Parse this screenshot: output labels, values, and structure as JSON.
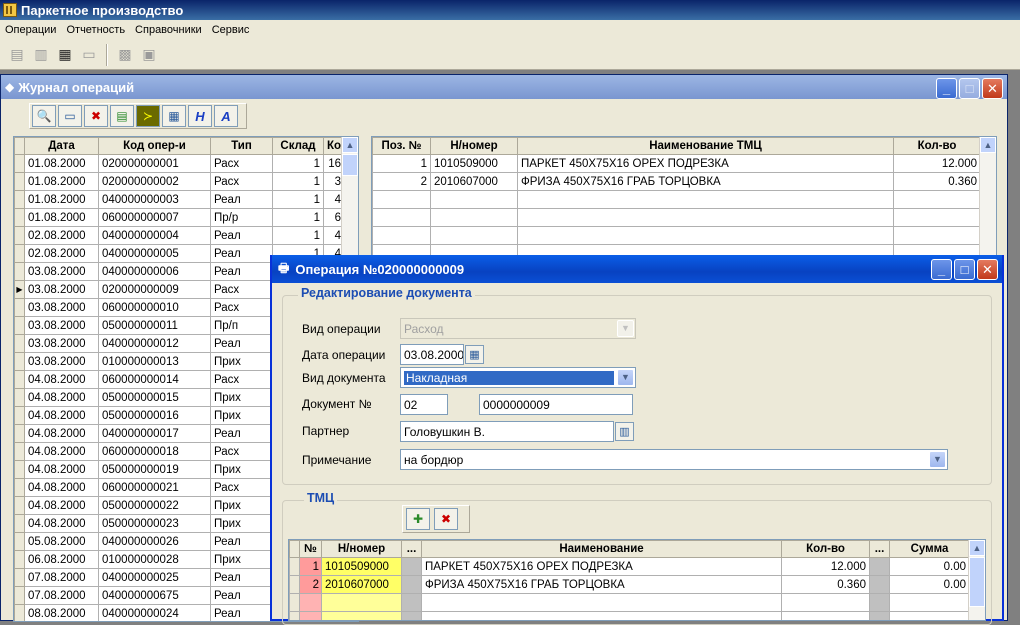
{
  "app": {
    "title": "Паркетное производство",
    "menu": [
      "Операции",
      "Отчетность",
      "Справочники",
      "Сервис"
    ]
  },
  "journal": {
    "title": "Журнал операций",
    "toolbar_letters": [
      "Н",
      "А"
    ],
    "left_headers": [
      "Дата",
      "Код опер-и",
      "Тип",
      "Склад",
      "Кол"
    ],
    "left_rows": [
      [
        "01.08.2000",
        "020000000001",
        "Расх",
        "1",
        "16"
      ],
      [
        "01.08.2000",
        "020000000002",
        "Расх",
        "1",
        "3"
      ],
      [
        "01.08.2000",
        "040000000003",
        "Реал",
        "1",
        "4"
      ],
      [
        "01.08.2000",
        "060000000007",
        "Пр/р",
        "1",
        "6"
      ],
      [
        "02.08.2000",
        "040000000004",
        "Реал",
        "1",
        "4"
      ],
      [
        "02.08.2000",
        "040000000005",
        "Реал",
        "1",
        "4"
      ],
      [
        "03.08.2000",
        "040000000006",
        "Реал",
        "",
        ""
      ],
      [
        "03.08.2000",
        "020000000009",
        "Расх",
        "",
        ""
      ],
      [
        "03.08.2000",
        "060000000010",
        "Расх",
        "",
        ""
      ],
      [
        "03.08.2000",
        "050000000011",
        "Пр/п",
        "",
        ""
      ],
      [
        "03.08.2000",
        "040000000012",
        "Реал",
        "",
        ""
      ],
      [
        "03.08.2000",
        "010000000013",
        "Прих",
        "",
        ""
      ],
      [
        "04.08.2000",
        "060000000014",
        "Расх",
        "",
        ""
      ],
      [
        "04.08.2000",
        "050000000015",
        "Прих",
        "",
        ""
      ],
      [
        "04.08.2000",
        "050000000016",
        "Прих",
        "",
        ""
      ],
      [
        "04.08.2000",
        "040000000017",
        "Реал",
        "",
        ""
      ],
      [
        "04.08.2000",
        "060000000018",
        "Расх",
        "",
        ""
      ],
      [
        "04.08.2000",
        "050000000019",
        "Прих",
        "",
        ""
      ],
      [
        "04.08.2000",
        "060000000021",
        "Расх",
        "",
        ""
      ],
      [
        "04.08.2000",
        "050000000022",
        "Прих",
        "",
        ""
      ],
      [
        "04.08.2000",
        "050000000023",
        "Прих",
        "",
        ""
      ],
      [
        "05.08.2000",
        "040000000026",
        "Реал",
        "",
        ""
      ],
      [
        "06.08.2000",
        "010000000028",
        "Прих",
        "",
        ""
      ],
      [
        "07.08.2000",
        "040000000025",
        "Реал",
        "",
        ""
      ],
      [
        "07.08.2000",
        "040000000675",
        "Реал",
        "",
        ""
      ],
      [
        "08.08.2000",
        "040000000024",
        "Реал",
        "",
        ""
      ]
    ],
    "current_row_index": 7,
    "right_headers": [
      "Поз. №",
      "Н/номер",
      "Наименование ТМЦ",
      "Кол-во"
    ],
    "right_rows": [
      [
        "1",
        "1010509000",
        "ПАРКЕТ 450X75X16 ОРЕХ ПОДРЕЗКА",
        "12.000"
      ],
      [
        "2",
        "2010607000",
        "ФРИЗА 450X75X16 ГРАБ ТОРЦОВКА",
        "0.360"
      ]
    ]
  },
  "dialog": {
    "title": "Операция №020000000009",
    "group_title": "Редактирование документа",
    "labels": {
      "op_type": "Вид операции",
      "op_date": "Дата операции",
      "doc_type": "Вид документа",
      "doc_no": "Документ №",
      "partner": "Партнер",
      "note": "Примечание"
    },
    "values": {
      "op_type": "Расход",
      "op_date": "03.08.2000",
      "doc_type": "Накладная",
      "doc_series": "02",
      "doc_number": "0000000009",
      "partner": "Головушкин В.",
      "note": "на бордюр"
    },
    "tmc_title": "ТМЦ",
    "tmc_headers": [
      "№",
      "Н/номер",
      "...",
      "Наименование",
      "Кол-во",
      "...",
      "Сумма"
    ],
    "tmc_rows": [
      [
        "1",
        "1010509000",
        "",
        "ПАРКЕТ 450X75X16 ОРЕХ ПОДРЕЗКА",
        "12.000",
        "",
        "0.00"
      ],
      [
        "2",
        "2010607000",
        "",
        "ФРИЗА 450X75X16 ГРАБ ТОРЦОВКА",
        "0.360",
        "",
        "0.00"
      ]
    ]
  }
}
